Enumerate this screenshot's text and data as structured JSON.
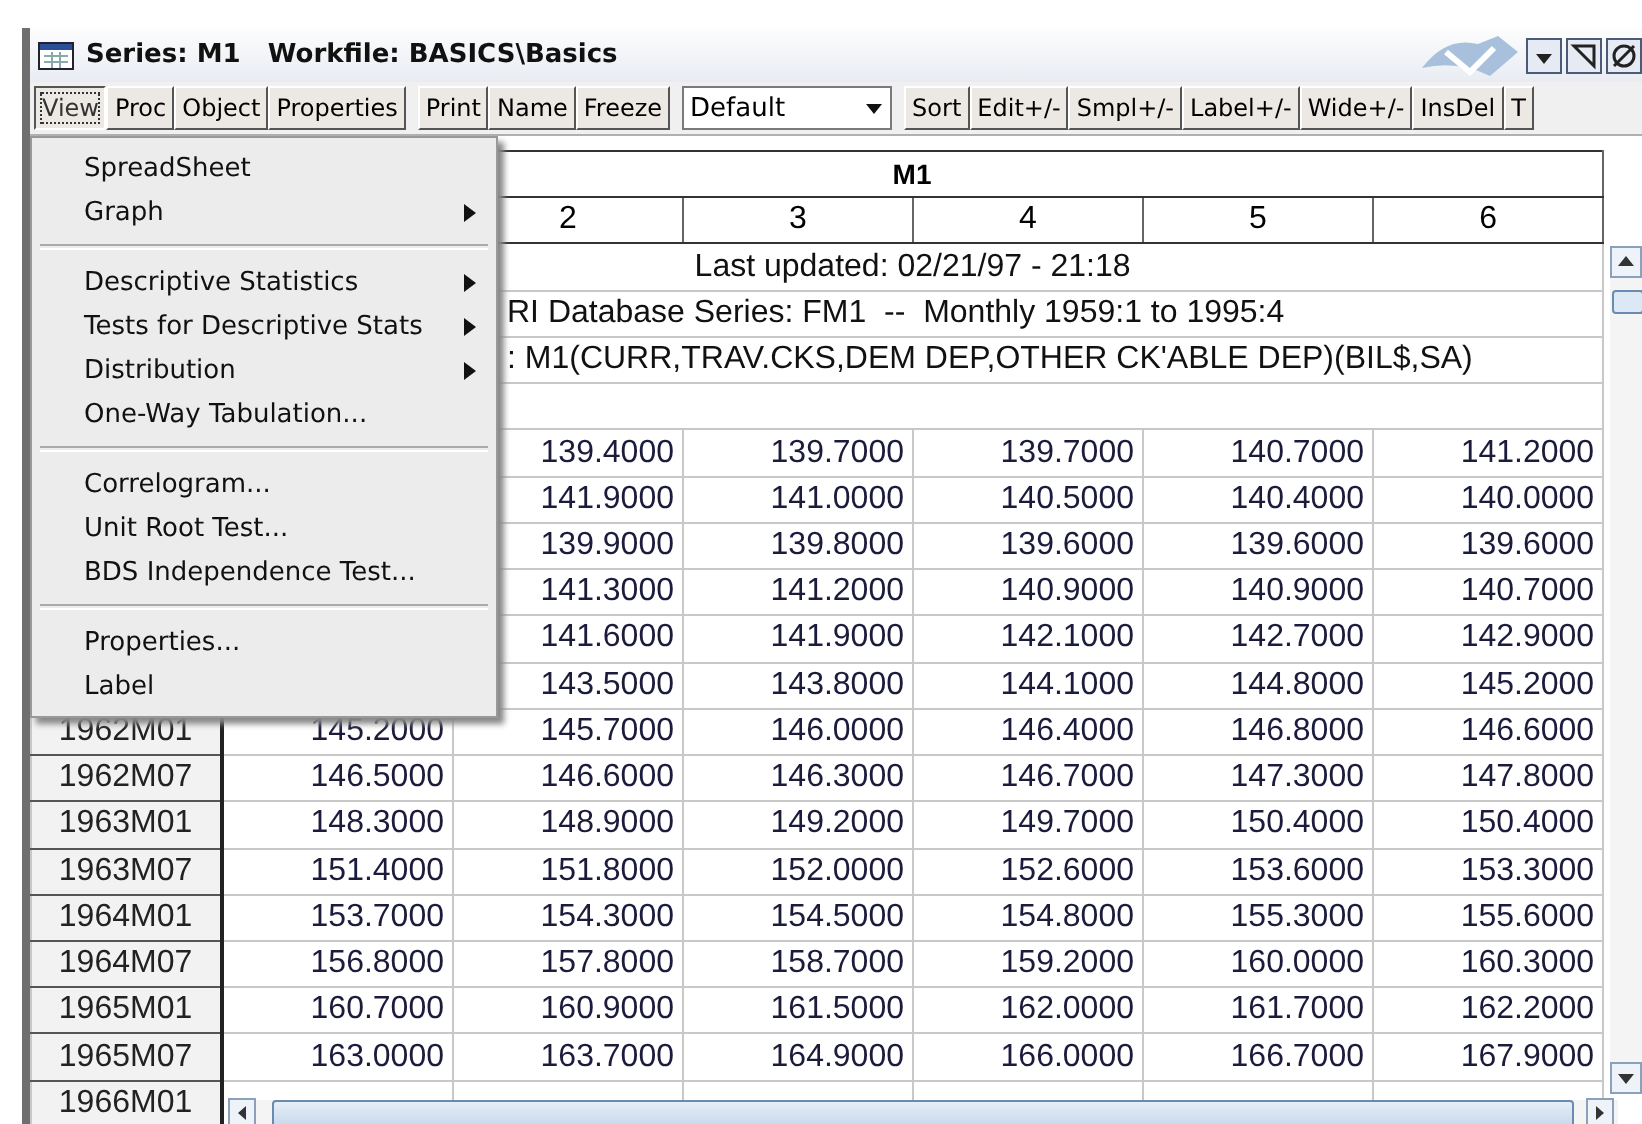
{
  "window": {
    "title": "Series: M1   Workfile: BASICS\\Basics"
  },
  "toolbar": {
    "groups": [
      [
        {
          "kind": "button",
          "label": "View",
          "pressed": true
        },
        {
          "kind": "button",
          "label": "Proc",
          "pressed": false
        },
        {
          "kind": "button",
          "label": "Object",
          "pressed": false
        },
        {
          "kind": "button",
          "label": "Properties",
          "pressed": false
        }
      ],
      [
        {
          "kind": "button",
          "label": "Print",
          "pressed": false
        },
        {
          "kind": "button",
          "label": "Name",
          "pressed": false
        },
        {
          "kind": "button",
          "label": "Freeze",
          "pressed": false
        }
      ],
      [
        {
          "kind": "dropdown",
          "value": "Default"
        }
      ],
      [
        {
          "kind": "button",
          "label": "Sort",
          "pressed": false
        },
        {
          "kind": "button",
          "label": "Edit+/-",
          "pressed": false
        },
        {
          "kind": "button",
          "label": "Smpl+/-",
          "pressed": false
        },
        {
          "kind": "button",
          "label": "Label+/-",
          "pressed": false
        },
        {
          "kind": "button",
          "label": "Wide+/-",
          "pressed": false
        },
        {
          "kind": "button",
          "label": "InsDel",
          "pressed": false
        },
        {
          "kind": "button",
          "label": "T",
          "pressed": false
        }
      ]
    ]
  },
  "view_menu": {
    "groups": [
      [
        {
          "label": "SpreadSheet",
          "submenu": false
        },
        {
          "label": "Graph",
          "submenu": true
        }
      ],
      [
        {
          "label": "Descriptive Statistics",
          "submenu": true
        },
        {
          "label": "Tests for Descriptive Stats",
          "submenu": true
        },
        {
          "label": "Distribution",
          "submenu": true
        },
        {
          "label": "One-Way Tabulation...",
          "submenu": false
        }
      ],
      [
        {
          "label": "Correlogram...",
          "submenu": false
        },
        {
          "label": "Unit Root Test...",
          "submenu": false
        },
        {
          "label": "BDS Independence Test...",
          "submenu": false
        }
      ],
      [
        {
          "label": "Properties...",
          "submenu": false
        },
        {
          "label": "Label",
          "submenu": false
        }
      ]
    ]
  },
  "grid": {
    "title": "M1",
    "columns": [
      "2",
      "3",
      "4",
      "5",
      "6"
    ],
    "notes": [
      {
        "kind": "center",
        "text": "Last updated: 02/21/97 - 21:18"
      },
      {
        "kind": "left",
        "text": "RI Database Series: FM1  --  Monthly 1959:1 to 1995:4"
      },
      {
        "kind": "left",
        "text": ": M1(CURR,TRAV.CKS,DEM DEP,OTHER CK'ABLE DEP)(BIL$,SA)"
      }
    ],
    "rows": [
      {
        "values": [
          "139.4000",
          "139.7000",
          "139.7000",
          "140.7000",
          "141.2000"
        ]
      },
      {
        "values": [
          "141.9000",
          "141.0000",
          "140.5000",
          "140.4000",
          "140.0000"
        ]
      },
      {
        "values": [
          "139.9000",
          "139.8000",
          "139.6000",
          "139.6000",
          "139.6000"
        ]
      },
      {
        "values": [
          "141.3000",
          "141.2000",
          "140.9000",
          "140.9000",
          "140.7000"
        ]
      },
      {
        "values": [
          "141.6000",
          "141.9000",
          "142.1000",
          "142.7000",
          "142.9000"
        ]
      },
      {
        "values": [
          "143.5000",
          "143.8000",
          "144.1000",
          "144.8000",
          "145.2000"
        ]
      },
      {
        "label": "1962M01",
        "values": [
          "145.2000",
          "145.7000",
          "146.0000",
          "146.4000",
          "146.8000",
          "146.6000"
        ]
      },
      {
        "label": "1962M07",
        "values": [
          "146.5000",
          "146.6000",
          "146.3000",
          "146.7000",
          "147.3000",
          "147.8000"
        ]
      },
      {
        "label": "1963M01",
        "values": [
          "148.3000",
          "148.9000",
          "149.2000",
          "149.7000",
          "150.4000",
          "150.4000"
        ]
      },
      {
        "label": "1963M07",
        "values": [
          "151.4000",
          "151.8000",
          "152.0000",
          "152.6000",
          "153.6000",
          "153.3000"
        ]
      },
      {
        "label": "1964M01",
        "values": [
          "153.7000",
          "154.3000",
          "154.5000",
          "154.8000",
          "155.3000",
          "155.6000"
        ]
      },
      {
        "label": "1964M07",
        "values": [
          "156.8000",
          "157.8000",
          "158.7000",
          "159.2000",
          "160.0000",
          "160.3000"
        ]
      },
      {
        "label": "1965M01",
        "values": [
          "160.7000",
          "160.9000",
          "161.5000",
          "162.0000",
          "161.7000",
          "162.2000"
        ]
      },
      {
        "label": "1965M07",
        "values": [
          "163.0000",
          "163.7000",
          "164.9000",
          "166.0000",
          "166.7000",
          "167.9000"
        ]
      },
      {
        "label": "1966M01",
        "values": []
      }
    ]
  }
}
